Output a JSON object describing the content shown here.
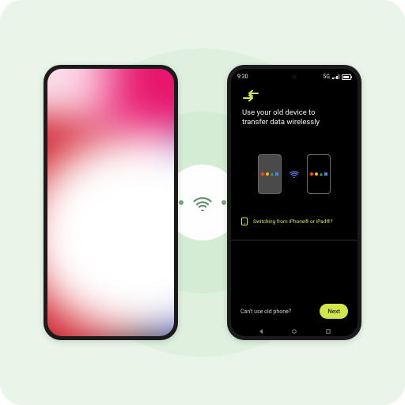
{
  "colors": {
    "stage_bg": "#e9f5e9",
    "accent_lime": "#d2e64a"
  },
  "center": {
    "wifi_icon": "wifi-icon"
  },
  "left_phone": {
    "kind": "source-phone-ios"
  },
  "right_phone": {
    "status": {
      "time": "9:30",
      "network": "5G"
    },
    "icons": {
      "migrate": "migrate-icon",
      "phone_link": "device-ipad-icon"
    },
    "headline_line1": "Use your old device to",
    "headline_line2": "transfer data wirelessly",
    "mini": {
      "wifi_icon": "wifi-icon"
    },
    "switch_link": "Switching from iPhone® or iPad®?",
    "secondary_link": "Can't use old phone?",
    "next_label": "Next"
  }
}
